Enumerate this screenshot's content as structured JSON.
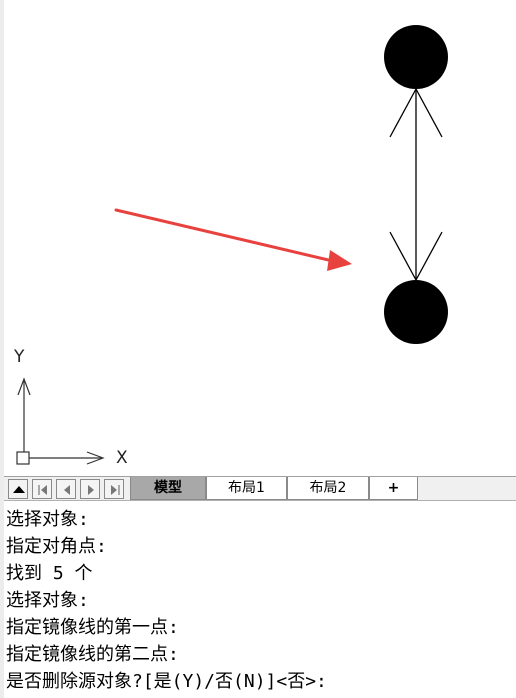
{
  "drawing": {
    "ucs": {
      "x_label": "X",
      "y_label": "Y"
    },
    "colors": {
      "entity": "#000000",
      "annotation_arrow": "#e8423f"
    }
  },
  "layout_tabs": {
    "nav_buttons": [
      "up-arrow-icon",
      "first-icon",
      "prev-icon",
      "next-icon",
      "last-icon"
    ],
    "tabs": [
      {
        "label": "模型",
        "active": true
      },
      {
        "label": "布局1",
        "active": false
      },
      {
        "label": "布局2",
        "active": false
      },
      {
        "label": "+",
        "active": false
      }
    ]
  },
  "command_history": [
    "选择对象:",
    "指定对角点:",
    "找到 5 个",
    "选择对象:",
    "指定镜像线的第一点:",
    "指定镜像线的第二点:",
    "是否删除源对象?[是(Y)/否(N)]<否>:"
  ]
}
